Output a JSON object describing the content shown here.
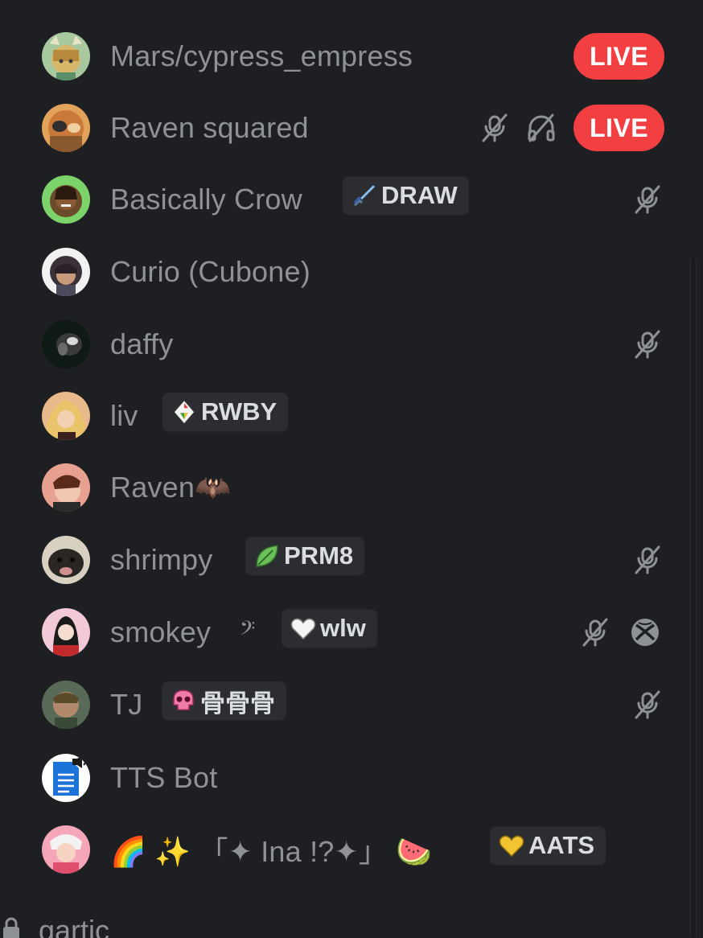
{
  "members": [
    {
      "name": "Mars/cypress_empress",
      "live": "LIVE"
    },
    {
      "name": "Raven squared",
      "live": "LIVE"
    },
    {
      "name": "Basically Crow",
      "tag": "DRAW",
      "tag_icon": "sword-icon"
    },
    {
      "name": "Curio (Cubone)"
    },
    {
      "name": "daffy"
    },
    {
      "name": "liv",
      "tag": "RWBY",
      "tag_icon": "crystal-icon"
    },
    {
      "name": "Raven🦇"
    },
    {
      "name": "shrimpy",
      "tag": "PRM8",
      "tag_icon": "leaf-icon"
    },
    {
      "name": "smokey",
      "note": "𝄢",
      "tag": "wlw",
      "tag_icon": "white-heart-icon"
    },
    {
      "name": "TJ",
      "tag": "骨骨骨",
      "tag_icon": "pink-skull-icon"
    },
    {
      "name": "TTS Bot"
    },
    {
      "name": "🌈 ✨ 「✦ Ina !?✦」 🍉",
      "tag": "AATS",
      "tag_icon": "gold-heart-icon"
    }
  ],
  "channel": {
    "name": "gartic",
    "icon": "lock-icon"
  },
  "colors": {
    "background": "#1e1f22",
    "name_text": "#8e9297",
    "tag_bg": "#2b2d31",
    "live_red": "#f23f42"
  }
}
